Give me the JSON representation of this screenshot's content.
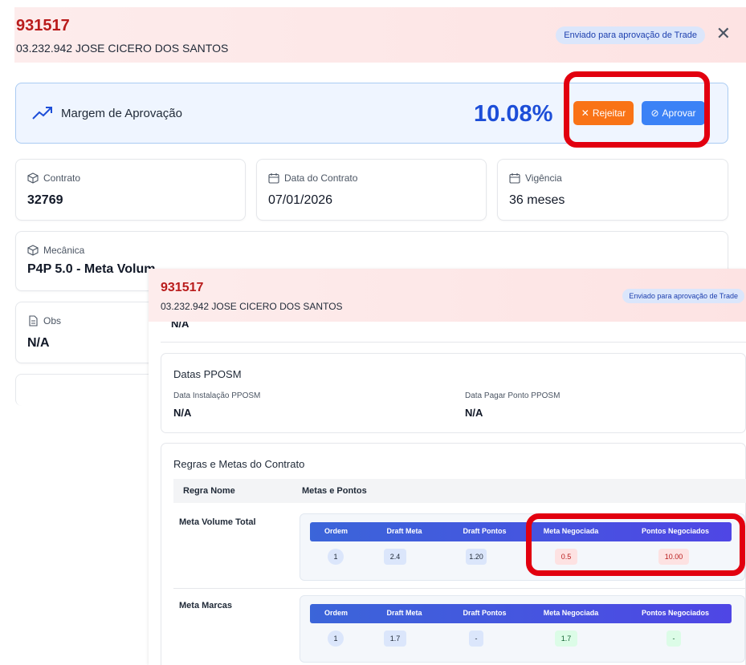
{
  "header": {
    "code": "931517",
    "client": "03.232.942 JOSE CICERO DOS SANTOS",
    "status_badge": "Enviado para aprovação de Trade",
    "close_icon": "close-icon"
  },
  "margin": {
    "label": "Margem de Aprovação",
    "value": "10.08%",
    "icon": "trending-up-icon",
    "reject_label": "Rejeitar",
    "approve_label": "Aprovar"
  },
  "info": {
    "contrato": {
      "label": "Contrato",
      "value": "32769",
      "icon": "package-icon"
    },
    "data_contrato": {
      "label": "Data do Contrato",
      "value": "07/01/2026",
      "icon": "calendar-icon"
    },
    "vigencia": {
      "label": "Vigência",
      "value": "36 meses",
      "icon": "calendar-icon"
    },
    "mecanica": {
      "label": "Mecânica",
      "value": "P4P 5.0 - Meta Volum",
      "icon": "package-icon"
    },
    "obs": {
      "label": "Obs",
      "value": "N/A",
      "icon": "document-icon"
    }
  },
  "overlay": {
    "code": "931517",
    "client": "03.232.942 JOSE CICERO DOS SANTOS",
    "status_badge": "Enviado para aprovação de Trade",
    "top_value": "N/A",
    "ppsom": {
      "title": "Datas PPOSM",
      "instalacao_label": "Data Instalação PPOSM",
      "instalacao_value": "N/A",
      "pagar_label": "Data Pagar Ponto PPOSM",
      "pagar_value": "N/A"
    },
    "rules": {
      "title": "Regras e Metas do Contrato",
      "col_rule": "Regra Nome",
      "col_goals": "Metas e Pontos",
      "table_headers": [
        "Ordem",
        "Draft Meta",
        "Draft Pontos",
        "Meta Negociada",
        "Pontos Negociados"
      ],
      "rows": [
        {
          "name": "Meta Volume Total",
          "ordem": "1",
          "draft_meta": "2.4",
          "draft_pontos": "1.20",
          "meta_negociada": "0.5",
          "pontos_negociados": "10.00"
        },
        {
          "name": "Meta Marcas",
          "ordem": "1",
          "draft_meta": "1.7",
          "draft_pontos": "-",
          "meta_negociada": "1.7",
          "pontos_negociados": "-"
        }
      ]
    }
  },
  "colors": {
    "header_bg": "#fde3e3",
    "code_red": "#b91c1c",
    "primary_blue": "#3b82f6",
    "reject_orange": "#f97316",
    "highlight_red": "#e2000f"
  }
}
